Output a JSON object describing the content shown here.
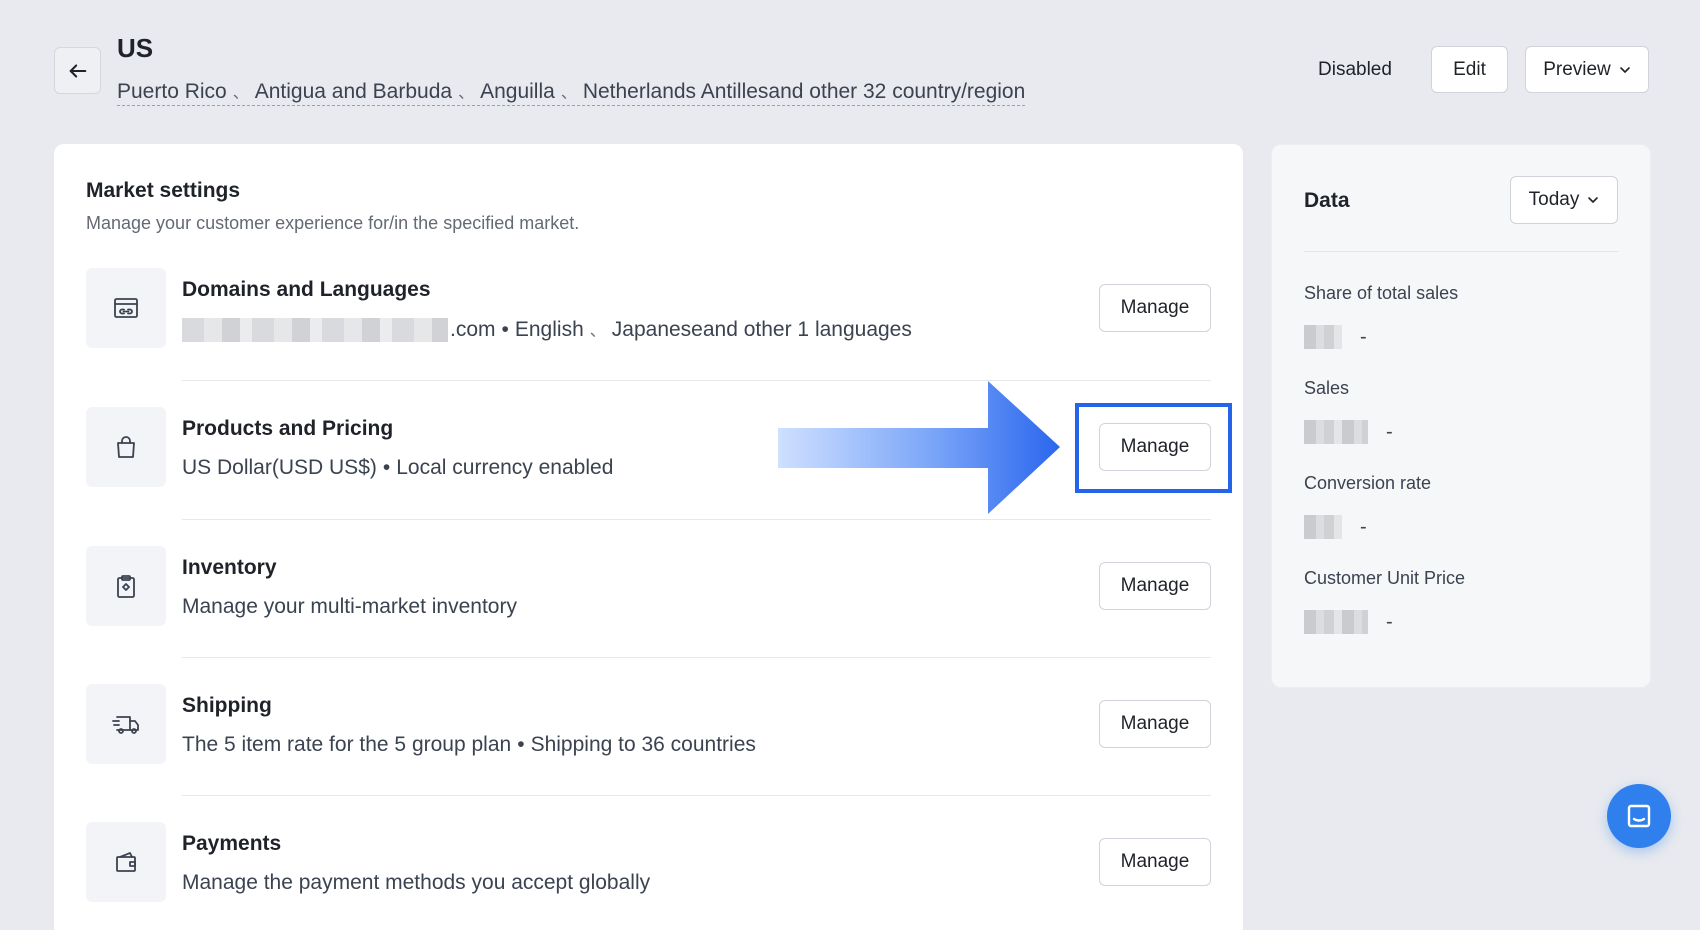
{
  "header": {
    "title": "US",
    "regions": [
      "Puerto Rico",
      "Antigua and Barbuda",
      "Anguilla",
      "Netherlands Antillesand other 32 country/region"
    ],
    "region_separator": "、",
    "status": "Disabled",
    "edit_label": "Edit",
    "preview_label": "Preview"
  },
  "market_settings": {
    "title": "Market settings",
    "subtitle": "Manage your customer experience for/in the specified market.",
    "rows": [
      {
        "title": "Domains and Languages",
        "icon": "domain-link-icon",
        "desc_suffix": ".com",
        "desc_lang1": "English",
        "desc_lang2": "Japaneseand other 1 languages",
        "manage_label": "Manage"
      },
      {
        "title": "Products and Pricing",
        "icon": "shopping-bag-icon",
        "desc_part1": "US Dollar(USD US$)",
        "desc_part2": "Local currency enabled",
        "manage_label": "Manage"
      },
      {
        "title": "Inventory",
        "icon": "clipboard-icon",
        "desc": "Manage your multi-market inventory",
        "manage_label": "Manage"
      },
      {
        "title": "Shipping",
        "icon": "truck-icon",
        "desc_part1": "The 5 item rate for the 5 group plan",
        "desc_part2": "Shipping to 36 countries",
        "manage_label": "Manage"
      },
      {
        "title": "Payments",
        "icon": "wallet-icon",
        "desc": "Manage the payment methods you accept globally",
        "manage_label": "Manage"
      }
    ]
  },
  "data_panel": {
    "title": "Data",
    "range_label": "Today",
    "metrics": [
      {
        "label": "Share of total sales",
        "value": "-"
      },
      {
        "label": "Sales",
        "value": "-"
      },
      {
        "label": "Conversion rate",
        "value": "-"
      },
      {
        "label": "Customer Unit Price",
        "value": "-"
      }
    ]
  },
  "colors": {
    "background": "#e8eaef",
    "highlight": "#2563eb",
    "chat": "#2f80ed"
  }
}
